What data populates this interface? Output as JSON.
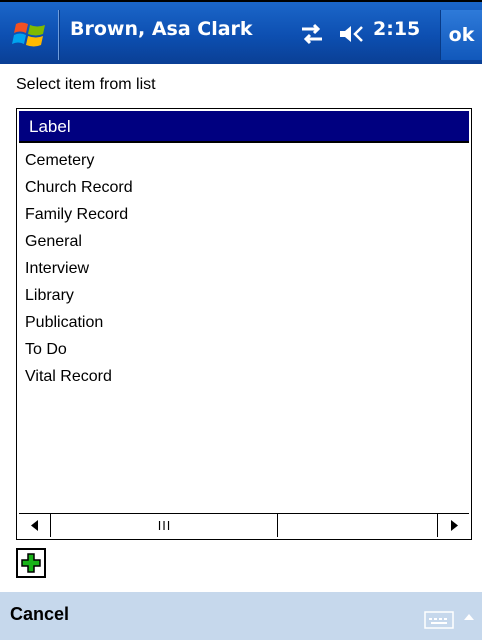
{
  "title_bar": {
    "start_icon": "windows-flag-icon",
    "title": "Brown, Asa Clark",
    "connectivity_icon": "connectivity-icon",
    "volume_icon": "speaker-icon",
    "clock": "2:15",
    "ok_label": "ok"
  },
  "prompt": "Select item from list",
  "list": {
    "header": "Label",
    "items": [
      "Cemetery",
      "Church Record",
      "Family Record",
      "General",
      "Interview",
      "Library",
      "Publication",
      "To Do",
      "Vital Record"
    ],
    "scroll_left_icon": "arrow-left-icon",
    "scroll_right_icon": "arrow-right-icon",
    "thumb_grip": "III"
  },
  "add_button_icon": "plus-icon",
  "menu_bar": {
    "cancel_label": "Cancel",
    "keyboard_icon": "keyboard-icon",
    "sip_up_icon": "chevron-up-icon"
  },
  "colors": {
    "title_bar": "#0d4fb1",
    "list_header": "#000080",
    "menu_bar": "#c6d8ec",
    "plus": "#18b418"
  }
}
